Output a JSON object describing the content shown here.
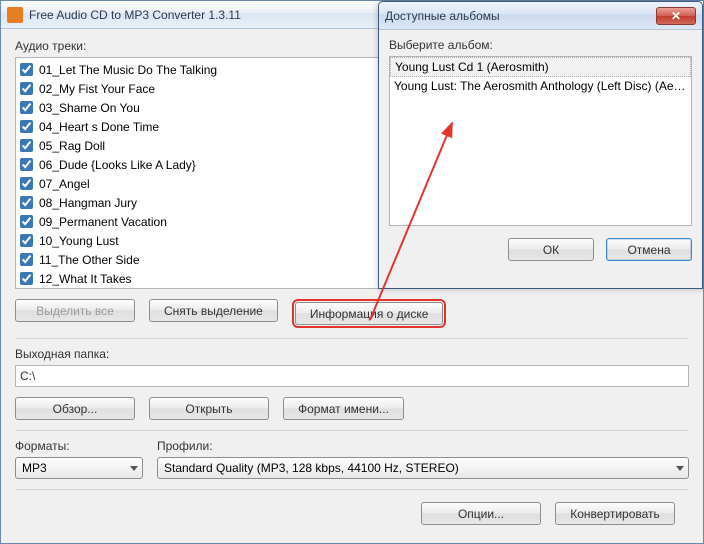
{
  "window": {
    "title": "Free Audio CD to MP3 Converter 1.3.11"
  },
  "labels": {
    "audio_tracks": "Аудио треки:",
    "output_folder": "Выходная папка:",
    "formats": "Форматы:",
    "profiles": "Профили:"
  },
  "tracks": [
    {
      "checked": true,
      "name": "01_Let The Music Do The Talking"
    },
    {
      "checked": true,
      "name": "02_My Fist Your Face"
    },
    {
      "checked": true,
      "name": "03_Shame On You"
    },
    {
      "checked": true,
      "name": "04_Heart s Done Time"
    },
    {
      "checked": true,
      "name": "05_Rag Doll"
    },
    {
      "checked": true,
      "name": "06_Dude {Looks Like A Lady}"
    },
    {
      "checked": true,
      "name": "07_Angel"
    },
    {
      "checked": true,
      "name": "08_Hangman Jury"
    },
    {
      "checked": true,
      "name": "09_Permanent Vacation"
    },
    {
      "checked": true,
      "name": "10_Young Lust"
    },
    {
      "checked": true,
      "name": "11_The Other Side"
    },
    {
      "checked": true,
      "name": "12_What It Takes"
    }
  ],
  "buttons": {
    "select_all": "Выделить все",
    "deselect_all": "Снять выделение",
    "disc_info": "Информация о диске",
    "browse": "Обзор...",
    "open": "Открыть",
    "name_format": "Формат имени...",
    "options": "Опции...",
    "convert": "Конвертировать"
  },
  "output_path": "C:\\",
  "format_value": "MP3",
  "profile_value": "Standard Quality (MP3, 128 kbps, 44100 Hz, STEREO)",
  "dialog": {
    "title": "Доступные альбомы",
    "choose_label": "Выберите альбом:",
    "albums": [
      "Young Lust Cd 1 (Aerosmith)",
      "Young Lust: The Aerosmith Anthology (Left Disc) (Aeros..."
    ],
    "ok": "ОК",
    "cancel": "Отмена"
  }
}
